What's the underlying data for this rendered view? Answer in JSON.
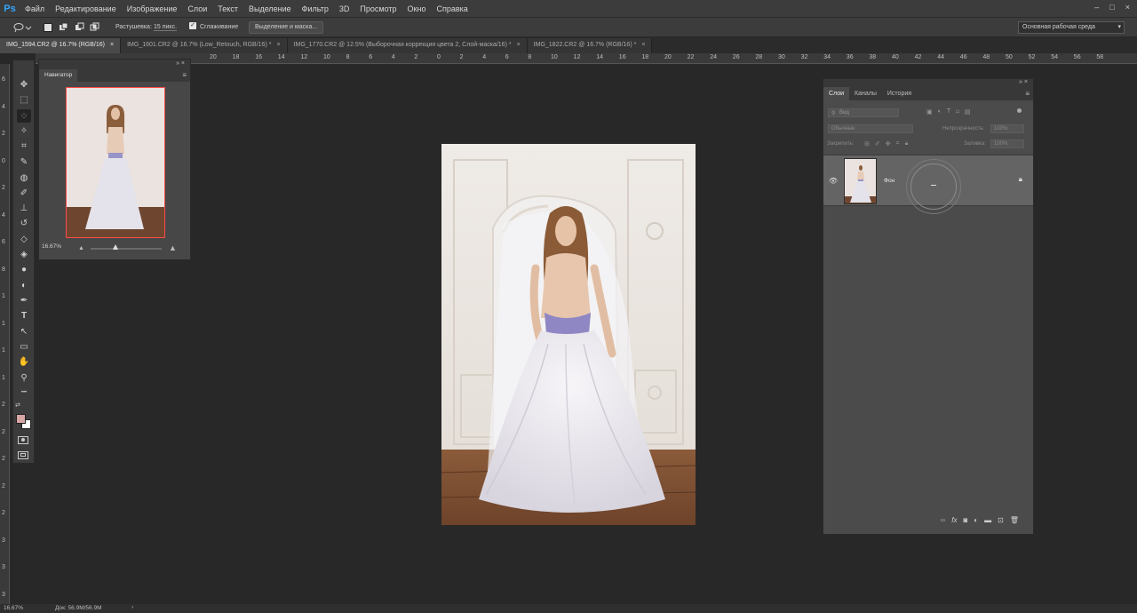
{
  "app": {
    "logo": "Ps"
  },
  "menu": [
    "Файл",
    "Редактирование",
    "Изображение",
    "Слои",
    "Текст",
    "Выделение",
    "Фильтр",
    "3D",
    "Просмотр",
    "Окно",
    "Справка"
  ],
  "window_controls": {
    "minimize": "–",
    "maximize": "□",
    "close": "×"
  },
  "options": {
    "feather_label": "Растушевка:",
    "feather_value": "15 пикс.",
    "antialias_label": "Сглаживание",
    "select_mask_button": "Выделение и маска...",
    "workspace": "Основная рабочая среда"
  },
  "tabs": [
    {
      "label": "IMG_1594.CR2 @ 16.7% (RGB/16)",
      "close": "×"
    },
    {
      "label": "IMG_1601.CR2 @ 16.7% (Low_Retouch, RGB/16) *",
      "close": "×"
    },
    {
      "label": "IMG_1770.CR2 @ 12.5% (Выборочная коррекция цвета 2, Слой-маска/16) *",
      "close": "×"
    },
    {
      "label": "IMG_1822.CR2 @ 16.7% (RGB/16) *",
      "close": "×"
    }
  ],
  "ruler_top": [
    "20",
    "18",
    "16",
    "14",
    "12",
    "10",
    "8",
    "6",
    "4",
    "2",
    "0",
    "2",
    "4",
    "6",
    "8",
    "10",
    "12",
    "14",
    "16",
    "18",
    "20",
    "22",
    "24",
    "26",
    "28",
    "30",
    "32",
    "34",
    "36",
    "38",
    "40",
    "42",
    "44",
    "46",
    "48",
    "50",
    "52",
    "54",
    "56",
    "58"
  ],
  "ruler_left": [
    "6",
    "4",
    "2",
    "0",
    "2",
    "4",
    "6",
    "8",
    "1",
    "1",
    "1",
    "1",
    "2",
    "2",
    "2",
    "2",
    "2",
    "3",
    "3",
    "3"
  ],
  "tools": {
    "move": "✥",
    "marquee": "⬚",
    "lasso": "◌",
    "wand": "✧",
    "crop": "⌗",
    "eyedropper": "✎",
    "healing": "◍",
    "brush": "✐",
    "stamp": "⊥",
    "history_brush": "↺",
    "eraser": "◇",
    "bucket": "◈",
    "blur": "●",
    "dodge": "◐",
    "pen": "✒",
    "type": "T",
    "path_select": "↖",
    "shape": "▭",
    "hand": "✋",
    "zoom": "⚲",
    "more": "•••"
  },
  "colors": {
    "foreground": "#d9a6a6",
    "background": "#ffffff",
    "accent_frame": "#ff4a4a"
  },
  "navigator": {
    "title": "Навигатор",
    "zoom": "16.67%"
  },
  "layers": {
    "tabs": [
      "Слои",
      "Каналы",
      "История"
    ],
    "filter_placeholder": "Вид",
    "blend_mode": "Обычные",
    "opacity_label": "Непрозрачность:",
    "opacity_value": "100%",
    "lock_label": "Закрепить:",
    "fill_label": "Заливка:",
    "fill_value": "100%",
    "layer_name": "Фон"
  },
  "status": {
    "zoom": "16.67%",
    "doc": "Док: 56.9M/56.9M",
    "arrow": "›"
  }
}
